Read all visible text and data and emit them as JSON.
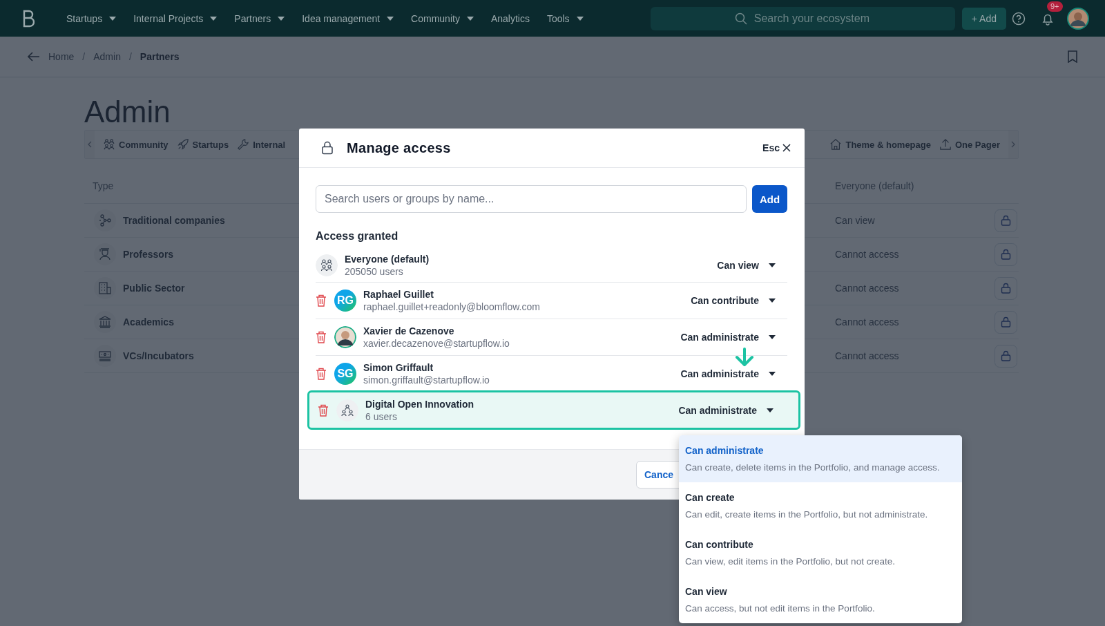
{
  "nav": {
    "items": [
      {
        "label": "Startups",
        "dropdown": true
      },
      {
        "label": "Internal Projects",
        "dropdown": true
      },
      {
        "label": "Partners",
        "dropdown": true
      },
      {
        "label": "Idea management",
        "dropdown": true
      },
      {
        "label": "Community",
        "dropdown": true
      },
      {
        "label": "Analytics",
        "dropdown": false
      },
      {
        "label": "Tools",
        "dropdown": true
      }
    ],
    "search": {
      "placeholder": "Search your ecosystem"
    },
    "add_button": "+ Add",
    "notification_badge": "9+"
  },
  "breadcrumb": {
    "items": [
      "Home",
      "Admin",
      "Partners"
    ],
    "separator": "/"
  },
  "page": {
    "title": "Admin",
    "tabs_left": [
      {
        "label": "Community",
        "kind": "people"
      },
      {
        "label": "Startups",
        "kind": "rocket"
      },
      {
        "label": "Internal",
        "kind": "wrench"
      }
    ],
    "tabs_right": [
      {
        "label": "Theme & homepage",
        "kind": "home"
      },
      {
        "label": "One Pager",
        "kind": "upload"
      }
    ],
    "table": {
      "columns": [
        "Type",
        "Everyone (default)"
      ],
      "rows": [
        {
          "type": "Traditional companies",
          "kind": "network",
          "access": "Can view"
        },
        {
          "type": "Professors",
          "kind": "professor",
          "access": "Cannot access"
        },
        {
          "type": "Public Sector",
          "kind": "building",
          "access": "Cannot access"
        },
        {
          "type": "Academics",
          "kind": "bank",
          "access": "Cannot access"
        },
        {
          "type": "VCs/Incubators",
          "kind": "money",
          "access": "Cannot access"
        }
      ]
    }
  },
  "modal": {
    "title": "Manage access",
    "close": "Esc",
    "search": {
      "placeholder": "Search users or groups by name..."
    },
    "add_button": "Add",
    "section": "Access granted",
    "entries": [
      {
        "name": "Everyone (default)",
        "detail": "205050 users",
        "role": "Can view",
        "removable": false,
        "highlighted": false,
        "avatar": {
          "kind": "group"
        }
      },
      {
        "name": "Raphael Guillet",
        "detail": "raphael.guillet+readonly@bloomflow.com",
        "role": "Can contribute",
        "removable": true,
        "highlighted": false,
        "avatar": {
          "kind": "initials",
          "text": "RG"
        }
      },
      {
        "name": "Xavier de Cazenove",
        "detail": "xavier.decazenove@startupflow.io",
        "role": "Can administrate",
        "removable": true,
        "highlighted": false,
        "avatar": {
          "kind": "photo"
        }
      },
      {
        "name": "Simon Griffault",
        "detail": "simon.griffault@startupflow.io",
        "role": "Can administrate",
        "removable": true,
        "highlighted": false,
        "avatar": {
          "kind": "initials",
          "text": "SG"
        }
      },
      {
        "name": "Digital Open Innovation",
        "detail": "6 users",
        "role": "Can administrate",
        "removable": true,
        "highlighted": true,
        "avatar": {
          "kind": "team"
        }
      }
    ],
    "cancel_button": "Cance"
  },
  "role_menu": [
    {
      "title": "Can administrate",
      "description": "Can create, delete items in the Portfolio, and manage access.",
      "selected": true
    },
    {
      "title": "Can create",
      "description": "Can edit, create items in the Portfolio, but not administrate.",
      "selected": false
    },
    {
      "title": "Can contribute",
      "description": "Can view, edit items in the Portfolio, but not create.",
      "selected": false
    },
    {
      "title": "Can view",
      "description": "Can access, but not edit items in the Portfolio.",
      "selected": false
    }
  ]
}
